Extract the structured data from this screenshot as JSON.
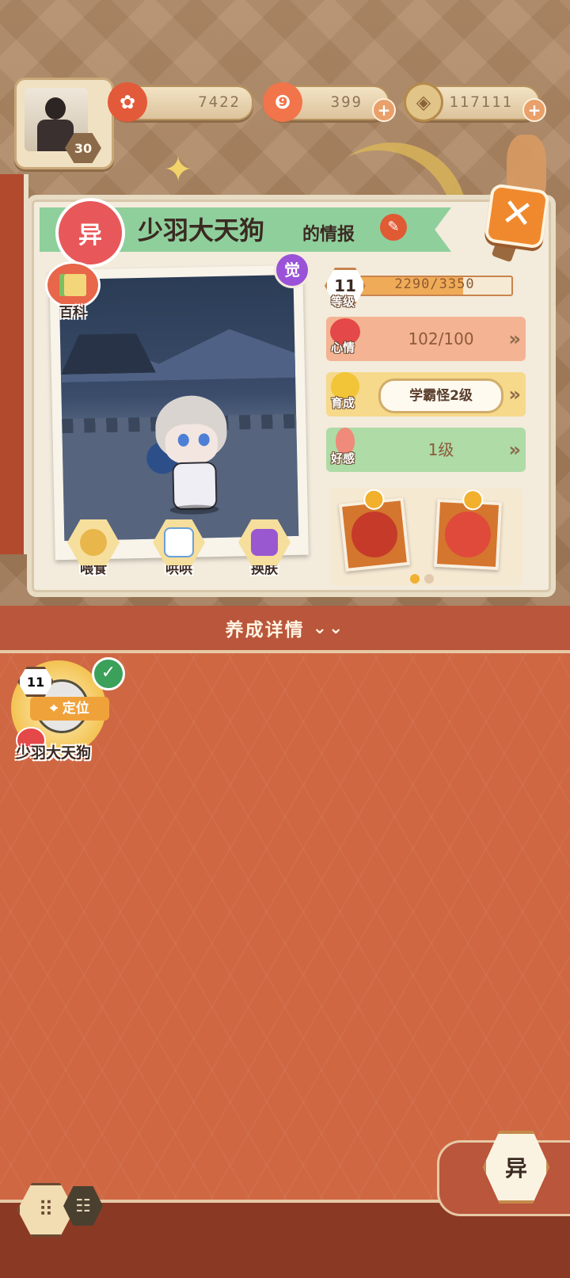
{
  "resources": {
    "player_level": "30",
    "coins": {
      "icon": "plum-blossom-icon",
      "value": "7422"
    },
    "gems": {
      "icon": "magatama-icon",
      "value": "399"
    },
    "money": {
      "icon": "coin-icon",
      "value": "117111"
    }
  },
  "card": {
    "badge": "异",
    "name": "少羽大天狗",
    "suffix": "的情报",
    "awaken_badge": "觉",
    "baike_label": "百科",
    "actions": [
      {
        "label": "喂食",
        "icon": "food-bowl-icon"
      },
      {
        "label": "哄哄",
        "icon": "milk-carton-icon"
      },
      {
        "label": "换肤",
        "icon": "kimono-icon"
      }
    ],
    "level": {
      "value": "11",
      "label": "等级",
      "exp_text": "2290/3350",
      "exp_fraction": 0.68
    },
    "mood": {
      "label": "心情",
      "value": "102/100"
    },
    "growth": {
      "label": "育成",
      "value": "学霸怪2级"
    },
    "favor": {
      "label": "好感",
      "value": "1级"
    },
    "gift_pages": 2,
    "gift_page_active": 1
  },
  "details_bar": {
    "label": "养成详情"
  },
  "roster": [
    {
      "level": "11",
      "locate_label": "定位",
      "name": "少羽大天狗",
      "selected": true
    }
  ],
  "footer": {
    "yi_label": "异"
  },
  "colors": {
    "accent_orange": "#cf6743",
    "mood_row": "#f4b392",
    "growth_row": "#f6d98a",
    "favor_row": "#aedba6"
  }
}
